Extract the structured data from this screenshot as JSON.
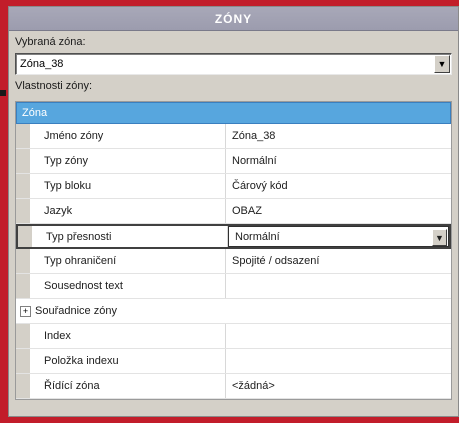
{
  "window": {
    "title": "ZÓNY"
  },
  "selected_zone": {
    "label": "Vybraná zóna:",
    "value": "Zóna_38",
    "arrow_icon": "chevron-down-icon"
  },
  "properties": {
    "label": "Vlastnosti zóny:",
    "category": "Zóna",
    "rows": [
      {
        "name": "Jméno zóny",
        "value": "Zóna_38"
      },
      {
        "name": "Typ zóny",
        "value": "Normální"
      },
      {
        "name": "Typ bloku",
        "value": "Čárový kód"
      },
      {
        "name": "Jazyk",
        "value": "OBAZ"
      },
      {
        "name": "Typ přesnosti",
        "value": "Normální"
      },
      {
        "name": "Typ ohraničení",
        "value": "Spojité / odsazení"
      },
      {
        "name": "Sousednost text",
        "value": ""
      }
    ],
    "group": {
      "name": "Souřadnice zóny",
      "expander": "+"
    },
    "rows2": [
      {
        "name": "Index",
        "value": ""
      },
      {
        "name": "Položka indexu",
        "value": ""
      },
      {
        "name": "Řídící zóna",
        "value": "<žádná>"
      }
    ]
  }
}
